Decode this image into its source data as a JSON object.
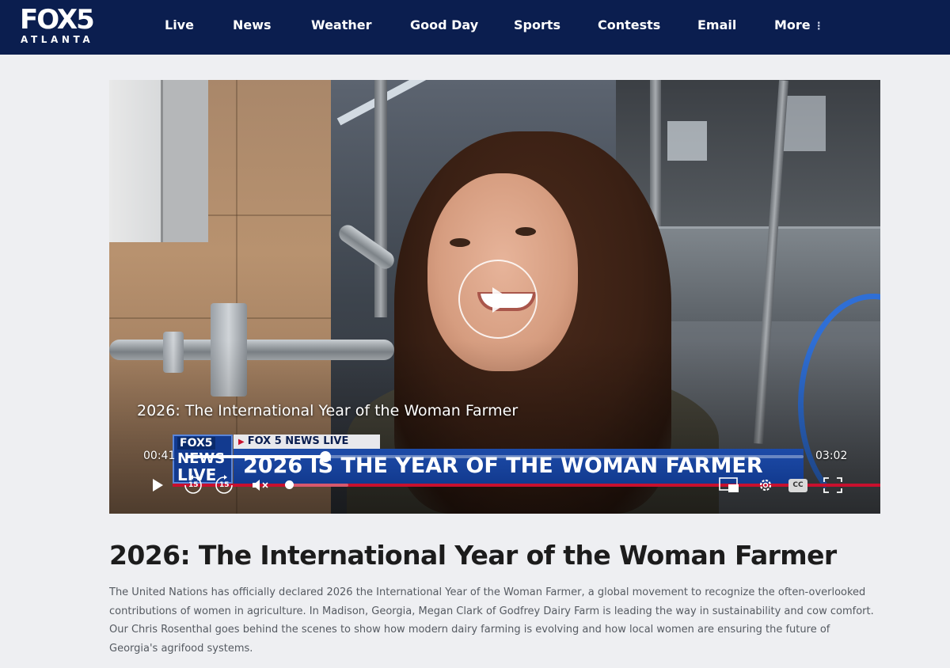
{
  "header": {
    "logo_main": "FOX5",
    "logo_sub": "ATLANTA",
    "nav": [
      {
        "label": "Live"
      },
      {
        "label": "News"
      },
      {
        "label": "Weather"
      },
      {
        "label": "Good Day"
      },
      {
        "label": "Sports"
      },
      {
        "label": "Contests"
      },
      {
        "label": "Email"
      },
      {
        "label": "More"
      }
    ]
  },
  "video": {
    "caption_title": "2026: The International Year of the Woman Farmer",
    "lower_third": {
      "badge_fox": "FOX5",
      "badge_news": "NEWS",
      "badge_live": "LIVE",
      "tag": "FOX 5 NEWS LIVE",
      "headline": "2026 IS THE YEAR OF THE WOMAN FARMER"
    },
    "time_elapsed": "00:41",
    "time_total": "03:02",
    "progress_fraction": 0.225,
    "volume_fraction": 0.0,
    "skip_back_label": "15",
    "skip_forward_label": "15",
    "cc_label": "CC",
    "icons": [
      "play-icon",
      "skip-back-icon",
      "skip-forward-icon",
      "mute-icon",
      "picture-in-picture-icon",
      "settings-icon",
      "closed-captions-icon",
      "fullscreen-icon"
    ]
  },
  "article": {
    "headline": "2026: The International Year of the Woman Farmer",
    "summary": "The United Nations has officially declared 2026 the International Year of the Woman Farmer, a global movement to recognize the often-overlooked contributions of women in agriculture. In Madison, Georgia, Megan Clark of Godfrey Dairy Farm is leading the way in sustainability and cow comfort. Our Chris Rosenthal goes behind the scenes to show how modern dairy farming is evolving and how local women are ensuring the future of Georgia's agrifood systems."
  },
  "colors": {
    "nav_bg": "#0b1e4f",
    "page_bg": "#eeeff2",
    "brand_red": "#c8102e",
    "lower_third_blue": "#123a8f"
  }
}
